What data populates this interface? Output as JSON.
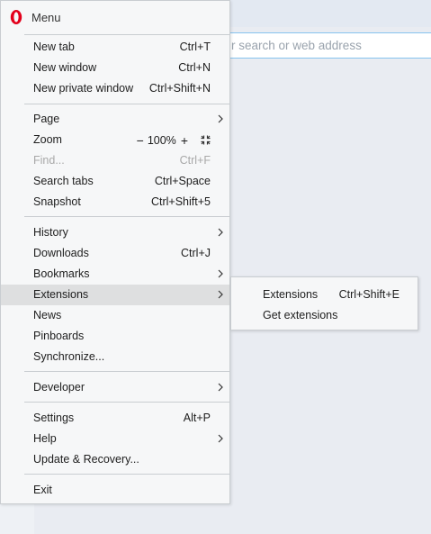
{
  "background": {
    "address_placeholder": "r search or web address"
  },
  "menu": {
    "title": "Menu",
    "logo_icon": "opera-logo-icon",
    "accent_color": "#e3001b",
    "groups": [
      [
        {
          "label": "New tab",
          "shortcut": "Ctrl+T"
        },
        {
          "label": "New window",
          "shortcut": "Ctrl+N"
        },
        {
          "label": "New private window",
          "shortcut": "Ctrl+Shift+N"
        }
      ],
      [
        {
          "label": "Page",
          "submenu": true
        },
        {
          "label": "Zoom",
          "zoom": {
            "minus": "−",
            "value": "100%",
            "plus": "+",
            "fullscreen_icon": "fullscreen-icon"
          }
        },
        {
          "label": "Find...",
          "shortcut": "Ctrl+F",
          "disabled": true
        },
        {
          "label": "Search tabs",
          "shortcut": "Ctrl+Space"
        },
        {
          "label": "Snapshot",
          "shortcut": "Ctrl+Shift+5"
        }
      ],
      [
        {
          "label": "History",
          "submenu": true
        },
        {
          "label": "Downloads",
          "shortcut": "Ctrl+J"
        },
        {
          "label": "Bookmarks",
          "submenu": true
        },
        {
          "label": "Extensions",
          "submenu": true,
          "highlighted": true
        },
        {
          "label": "News"
        },
        {
          "label": "Pinboards"
        },
        {
          "label": "Synchronize..."
        }
      ],
      [
        {
          "label": "Developer",
          "submenu": true
        }
      ],
      [
        {
          "label": "Settings",
          "shortcut": "Alt+P"
        },
        {
          "label": "Help",
          "submenu": true
        },
        {
          "label": "Update & Recovery..."
        }
      ],
      [
        {
          "label": "Exit"
        }
      ]
    ]
  },
  "submenu": {
    "items": [
      {
        "label": "Extensions",
        "shortcut": "Ctrl+Shift+E"
      },
      {
        "label": "Get extensions"
      }
    ]
  }
}
